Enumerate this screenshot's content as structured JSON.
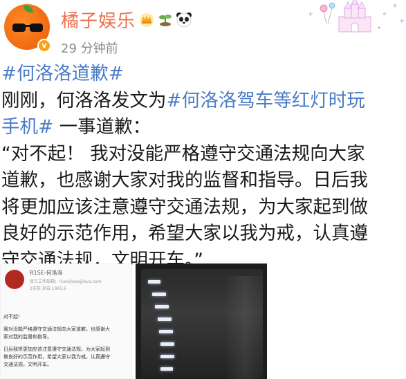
{
  "header": {
    "username": "橘子娱乐",
    "timestamp": "29 分钟前",
    "verified_badge": "v",
    "badges": [
      "crown-badge-icon",
      "plant-badge-icon",
      "panda-badge-icon"
    ]
  },
  "post": {
    "lines": [
      {
        "segments": [
          {
            "text": "#何洛洛道歉#",
            "hashtag": true
          }
        ]
      },
      {
        "segments": [
          {
            "text": "刚刚，何洛洛发文为",
            "hashtag": false
          },
          {
            "text": "#何洛洛驾车等红灯时玩",
            "hashtag": true
          }
        ]
      },
      {
        "segments": [
          {
            "text": "手机#",
            "hashtag": true
          },
          {
            "text": " 一事道歉：",
            "hashtag": false
          }
        ]
      },
      {
        "segments": [
          {
            "text": "“对不起！ 我对没能严格遵守交通法规向大家",
            "hashtag": false
          }
        ]
      },
      {
        "segments": [
          {
            "text": "道歉，也感谢大家对我的监督和指导。日后我",
            "hashtag": false
          }
        ]
      },
      {
        "segments": [
          {
            "text": "将更加应该注意遵守交通法规，为大家起到做",
            "hashtag": false
          }
        ]
      },
      {
        "segments": [
          {
            "text": "良好的示范作用，希望大家以我为戒，认真遵",
            "hashtag": false
          }
        ]
      },
      {
        "segments": [
          {
            "text": "守交通法规，文明开车。”",
            "hashtag": false
          }
        ]
      }
    ]
  },
  "thumbnail_1": {
    "name": "R1SE-何洛洛",
    "subtitle": "官方工作邮箱：r1se@swajjlova.com",
    "meta": "2天前  来自 1965.6",
    "lines": [
      "对不起!",
      "",
      "我对没能严格遵守交通法规向大家道歉，也感谢大",
      "家对我的监督和指导。",
      "",
      "日后我将更加应该注意遵守交通法规，为大家起到",
      "做良好的示范作用，希望大家以我为戒，认真遵守",
      "交通法规，文明开车。"
    ]
  },
  "colors": {
    "username": "#eb7350",
    "hashtag": "#4a7cc7",
    "timestamp": "#8a8a8a",
    "text": "#1a1a1a"
  }
}
